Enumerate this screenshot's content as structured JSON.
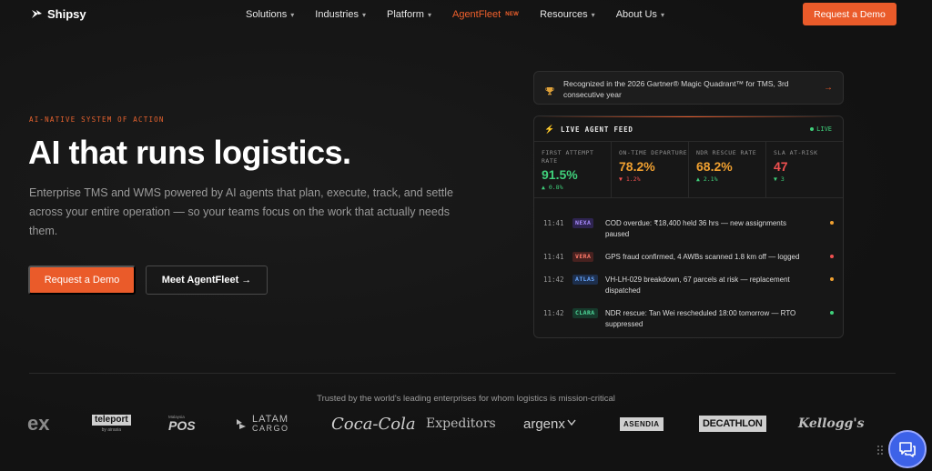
{
  "brand": {
    "name": "Shipsy"
  },
  "nav": {
    "items": [
      {
        "label": "Solutions",
        "chevron": "▾"
      },
      {
        "label": "Industries",
        "chevron": "▾"
      },
      {
        "label": "Platform",
        "chevron": "▾"
      },
      {
        "label": "AgentFleet",
        "badge": "NEW"
      },
      {
        "label": "Resources",
        "chevron": "▾"
      },
      {
        "label": "About Us",
        "chevron": "▾"
      }
    ],
    "cta": "Request a Demo"
  },
  "hero": {
    "eyebrow": "AI-NATIVE SYSTEM OF ACTION",
    "headline": "AI that runs logistics.",
    "subcopy": "Enterprise TMS and WMS powered by AI agents that plan, execute, track, and settle across your entire operation — so your teams focus on the work that actually needs them.",
    "primary_cta": "Request a Demo",
    "secondary_cta": "Meet AgentFleet →"
  },
  "recognition": {
    "text": "Recognized in the 2026 Gartner® Magic Quadrant™ for TMS, 3rd consecutive year",
    "icon": "trophy-icon",
    "arrow": "→"
  },
  "feed": {
    "title": "LIVE AGENT FEED",
    "live_label": "LIVE",
    "metrics": [
      {
        "label": "FIRST ATTEMPT RATE",
        "value": "91.5%",
        "delta": "▲ 0.8%",
        "value_color": "#3fcf7a",
        "delta_color": "#3fcf7a"
      },
      {
        "label": "ON-TIME DEPARTURE",
        "value": "78.2%",
        "delta": "▼ 1.2%",
        "value_color": "#f0a030",
        "delta_color": "#f05050"
      },
      {
        "label": "NDR RESCUE RATE",
        "value": "68.2%",
        "delta": "▲ 2.1%",
        "value_color": "#f0a030",
        "delta_color": "#3fcf7a"
      },
      {
        "label": "SLA AT-RISK",
        "value": "47",
        "delta": "▼ 3",
        "value_color": "#f05050",
        "delta_color": "#3fcf7a"
      }
    ],
    "rows": [
      {
        "time": "11:41",
        "tag": "NEXA",
        "tag_bg": "#2e2450",
        "tag_color": "#a98cff",
        "message": "COD overdue: ₹18,400 held 36 hrs — new assignments paused",
        "dot": "#f0a030"
      },
      {
        "time": "11:41",
        "tag": "VERA",
        "tag_bg": "#47211f",
        "tag_color": "#ff7a6a",
        "message": "GPS fraud confirmed, 4 AWBs scanned 1.8 km off — logged",
        "dot": "#f05050"
      },
      {
        "time": "11:42",
        "tag": "ATLAS",
        "tag_bg": "#1d2f4d",
        "tag_color": "#6aa8ff",
        "message": "VH-LH-029 breakdown, 67 parcels at risk — replacement dispatched",
        "dot": "#f0a030"
      },
      {
        "time": "11:42",
        "tag": "CLARA",
        "tag_bg": "#173a2c",
        "tag_color": "#4fd99a",
        "message": "NDR rescue: Tan Wei rescheduled 18:00 tomorrow — RTO suppressed",
        "dot": "#3fcf7a"
      }
    ]
  },
  "trust": {
    "heading": "Trusted by the world's leading enterprises for whom logistics is mission-critical",
    "logos": [
      "ex",
      "teleport",
      "by airasia",
      "Malaysia",
      "POS",
      "LATAM",
      "CARGO",
      "Coca-Cola",
      "Expeditors",
      "argenx",
      "ASENDIA",
      "DECATHLON",
      "Kellogg's"
    ]
  }
}
